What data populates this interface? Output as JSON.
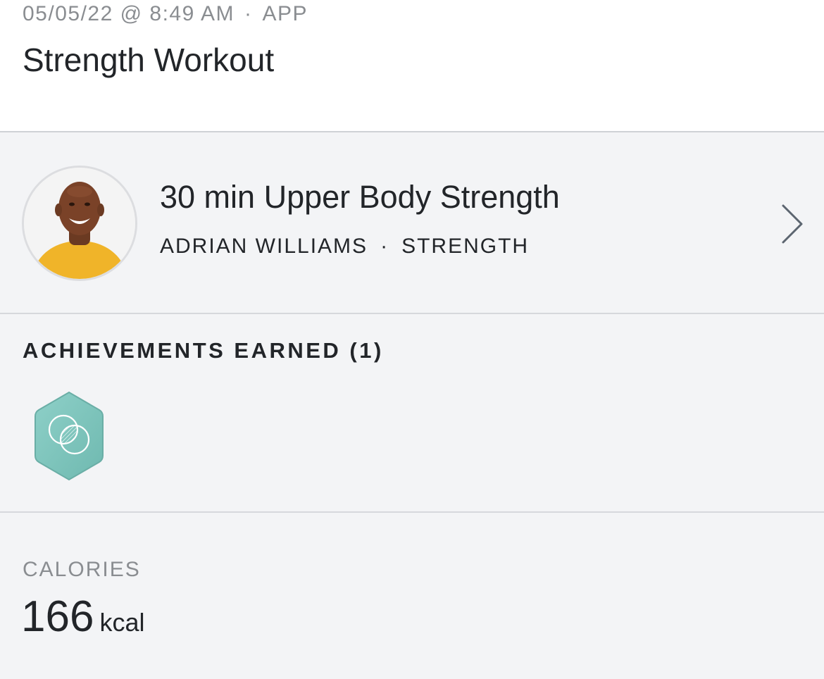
{
  "workout": {
    "date_time": "05/05/22 @ 8:49 AM",
    "separator": "·",
    "source": "APP",
    "title": "Strength Workout"
  },
  "class_info": {
    "title": "30 min Upper Body Strength",
    "instructor": "ADRIAN WILLIAMS",
    "separator": "·",
    "category": "STRENGTH",
    "avatar_icon": "instructor-avatar",
    "chevron_icon": "chevron-right-icon"
  },
  "achievements": {
    "heading": "ACHIEVEMENTS EARNED (1)",
    "badges": [
      {
        "icon": "overlapping-circles-badge-icon",
        "color": "#7fc4bc"
      }
    ]
  },
  "calories": {
    "label": "CALORIES",
    "value": "166",
    "unit": "kcal"
  },
  "colors": {
    "background": "#f3f4f6",
    "header_bg": "#ffffff",
    "muted_text": "#8a8d91",
    "primary_text": "#222529",
    "badge": "#7fc4bc",
    "divider": "#d6d8dc"
  }
}
